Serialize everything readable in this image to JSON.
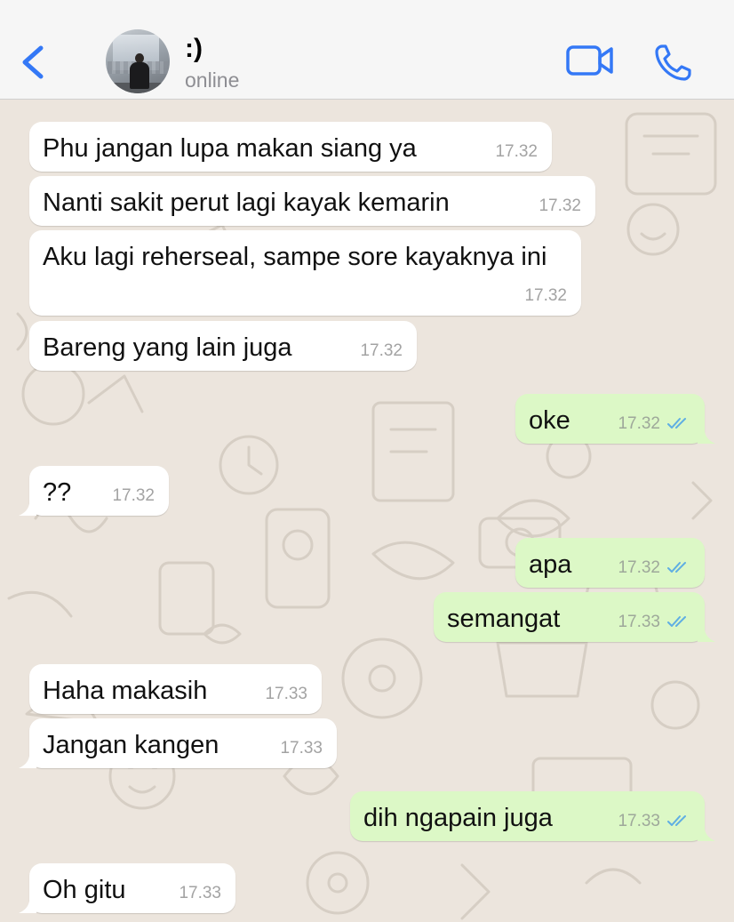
{
  "header": {
    "contact_name": ":)",
    "status": "online",
    "back_icon": "chevron-left-icon",
    "video_icon": "video-camera-icon",
    "phone_icon": "phone-icon"
  },
  "colors": {
    "accent": "#3478F6",
    "incoming_bubble": "#FFFFFF",
    "outgoing_bubble": "#DCF8C6",
    "read_ticks": "#5FAEE3",
    "wallpaper": "#ECE5DD"
  },
  "messages": [
    {
      "dir": "in",
      "text": "Phu jangan lupa makan siang ya",
      "time": "17.32"
    },
    {
      "dir": "in",
      "text": "Nanti sakit perut lagi kayak kemarin",
      "time": "17.32"
    },
    {
      "dir": "in",
      "text": "Aku lagi reherseal, sampe sore kayaknya ini",
      "time": "17.32"
    },
    {
      "dir": "in",
      "text": "Bareng yang lain juga",
      "time": "17.32"
    },
    {
      "dir": "out",
      "text": "oke",
      "time": "17.32",
      "status": "read"
    },
    {
      "dir": "in",
      "text": "??",
      "time": "17.32"
    },
    {
      "dir": "out",
      "text": "apa",
      "time": "17.32",
      "status": "read"
    },
    {
      "dir": "out",
      "text": "semangat",
      "time": "17.33",
      "status": "read"
    },
    {
      "dir": "in",
      "text": "Haha makasih",
      "time": "17.33"
    },
    {
      "dir": "in",
      "text": "Jangan kangen",
      "time": "17.33"
    },
    {
      "dir": "out",
      "text": "dih ngapain juga",
      "time": "17.33",
      "status": "read"
    },
    {
      "dir": "in",
      "text": "Oh gitu",
      "time": "17.33"
    }
  ]
}
